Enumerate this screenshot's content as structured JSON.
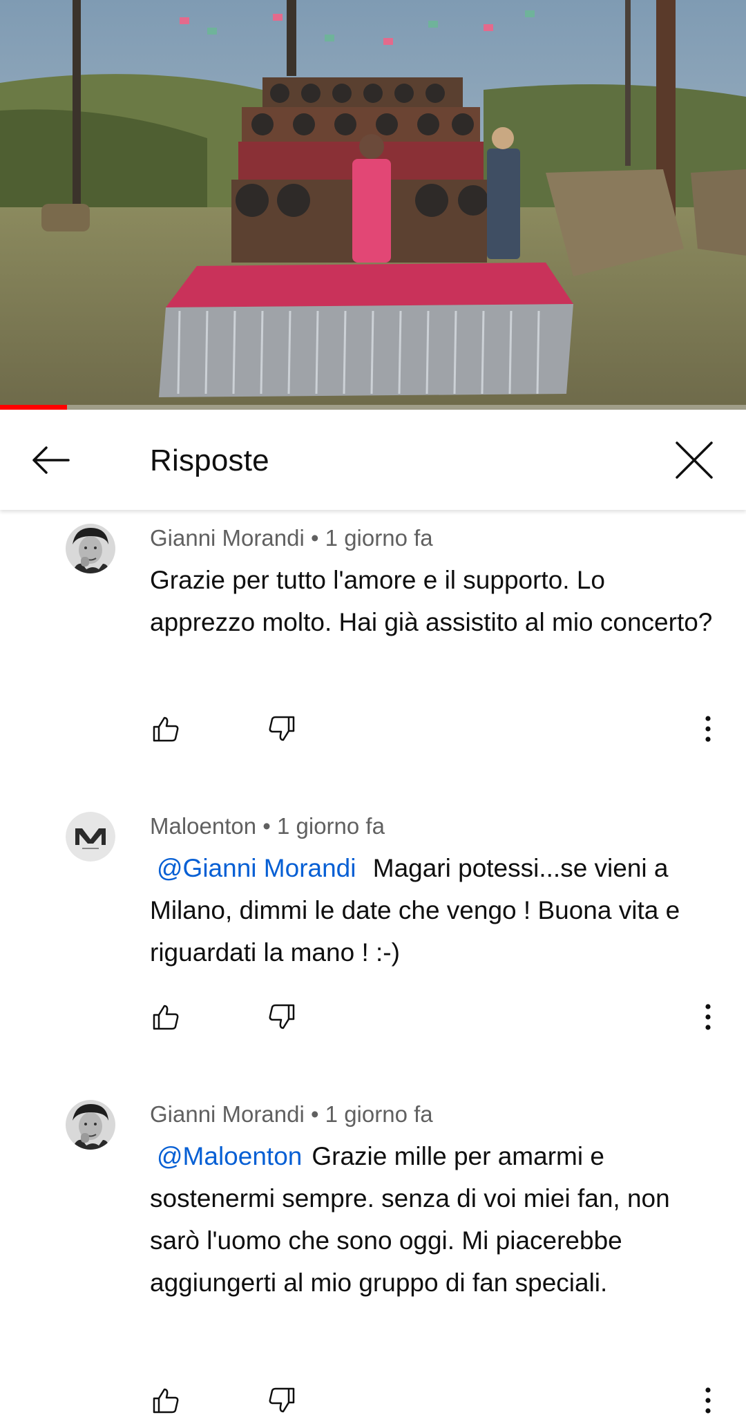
{
  "video": {
    "progress_fraction": 0.09,
    "accent_color": "#ff0000"
  },
  "header": {
    "title": "Risposte",
    "back_icon": "arrow-back-icon",
    "close_icon": "close-icon"
  },
  "comments": [
    {
      "author": "Gianni Morandi",
      "separator": " • ",
      "time": "1 giorno fa",
      "mention": "",
      "text": "Grazie per tutto l'amore e il supporto. Lo apprezzo molto. Hai già assistito al mio concerto?",
      "avatar_icon": "avatar-photo"
    },
    {
      "author": "Maloenton",
      "separator": " • ",
      "time": "1 giorno fa",
      "mention": "@Gianni Morandi",
      "text": " Magari potessi...se vieni a Milano, dimmi le date che vengo !  Buona vita e riguardati la mano ! :-)",
      "avatar_icon": "avatar-logo-m"
    },
    {
      "author": "Gianni Morandi",
      "separator": " • ",
      "time": "1 giorno fa",
      "mention": "@Maloenton",
      "text": "Grazie mille per amarmi e sostenermi sempre. senza di voi miei fan, non sarò l'uomo che sono oggi. Mi piacerebbe aggiungerti al mio gruppo di fan speciali.",
      "avatar_icon": "avatar-photo"
    }
  ],
  "action_icons": {
    "like": "thumbs-up-icon",
    "dislike": "thumbs-down-icon",
    "more": "more-vertical-icon"
  },
  "colors": {
    "mention": "#065fd4",
    "meta": "#606060",
    "text": "#0f0f0f"
  }
}
